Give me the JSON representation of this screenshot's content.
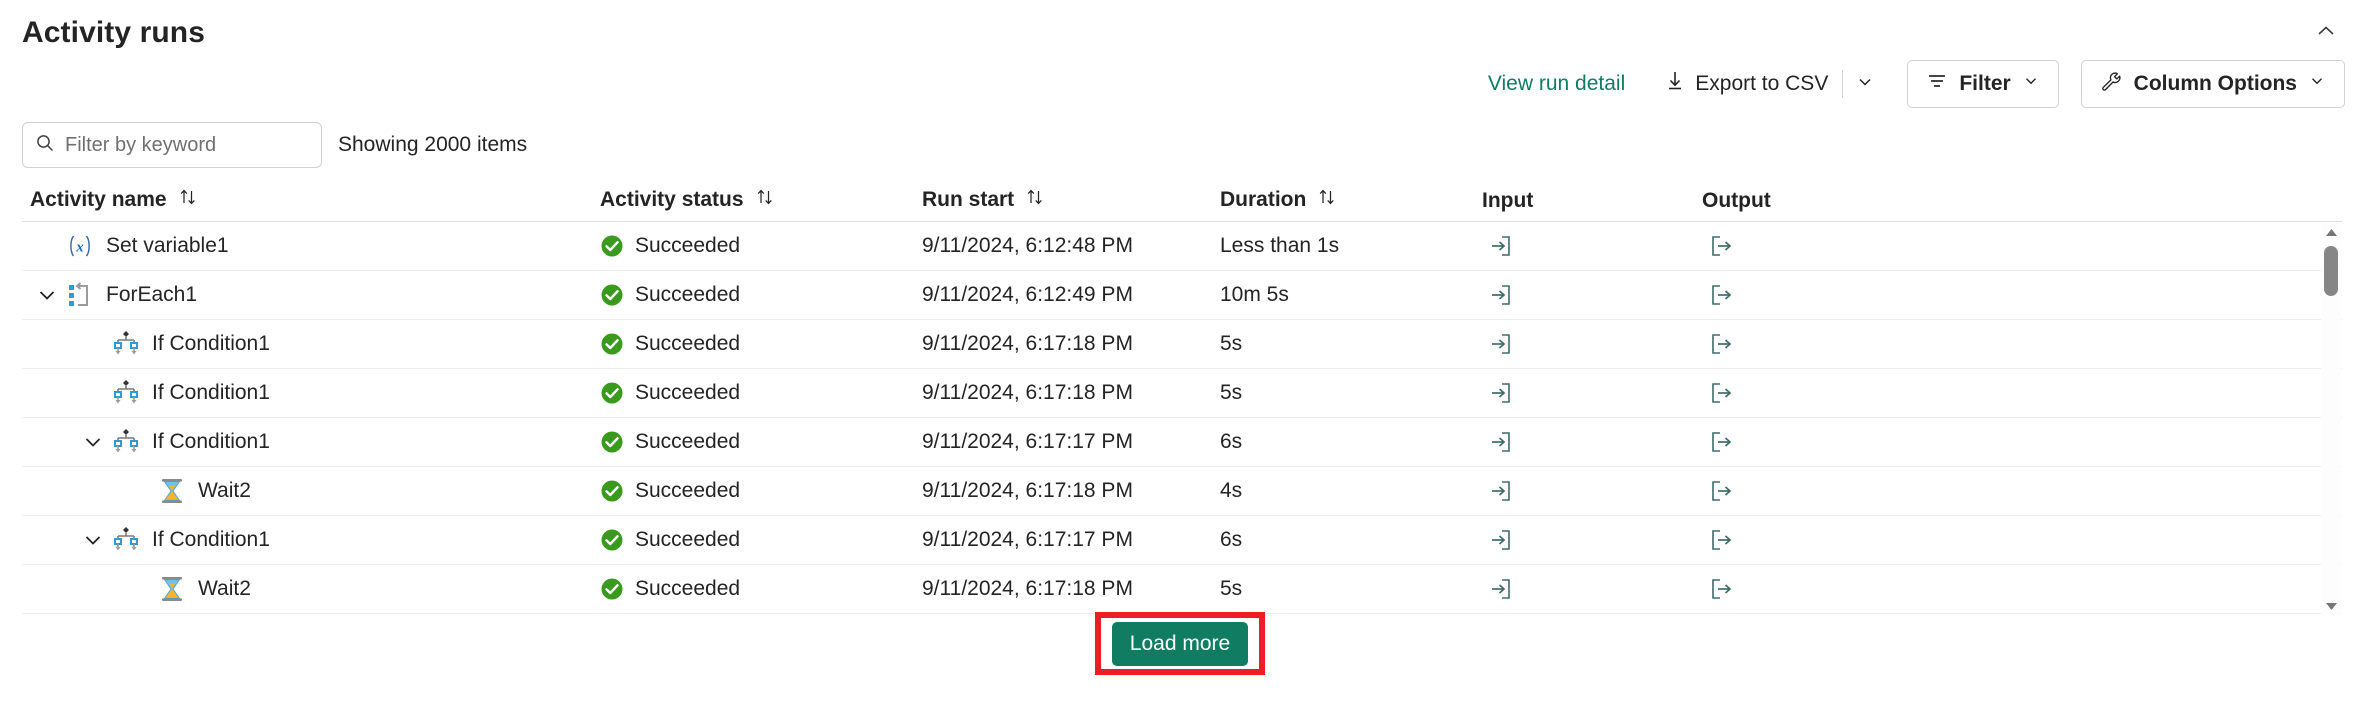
{
  "header": {
    "title": "Activity runs",
    "collapse_icon": "chevron-up-icon"
  },
  "toolbar": {
    "view_run_detail": "View run detail",
    "export_csv": "Export to CSV",
    "export_icon": "download-arrow-icon",
    "export_caret_icon": "chevron-down-icon",
    "filter": "Filter",
    "filter_icon": "filter-lines-icon",
    "filter_caret_icon": "chevron-down-icon",
    "column_options": "Column Options",
    "column_options_icon": "wrench-icon",
    "column_options_caret_icon": "chevron-down-icon"
  },
  "search": {
    "placeholder": "Filter by keyword",
    "value": "",
    "icon": "search-icon"
  },
  "status_line": "Showing 2000 items",
  "table": {
    "columns": [
      {
        "key": "name",
        "label": "Activity name",
        "sortable": true,
        "sort_icon": "sort-arrows-icon"
      },
      {
        "key": "status",
        "label": "Activity status",
        "sortable": true,
        "sort_icon": "sort-arrows-icon"
      },
      {
        "key": "start",
        "label": "Run start",
        "sortable": true,
        "sort_icon": "sort-arrows-icon"
      },
      {
        "key": "dur",
        "label": "Duration",
        "sortable": true,
        "sort_icon": "sort-arrows-icon"
      },
      {
        "key": "in",
        "label": "Input",
        "sortable": false,
        "sort_icon": ""
      },
      {
        "key": "out",
        "label": "Output",
        "sortable": false,
        "sort_icon": ""
      }
    ],
    "rows": [
      {
        "name": "Set variable1",
        "icon": "set-variable-icon",
        "indent": 0,
        "expandable": false,
        "expanded": false,
        "status": "Succeeded",
        "status_icon": "success-check-icon",
        "status_color": "#3a9a1e",
        "start": "9/11/2024, 6:12:48 PM",
        "duration": "Less than 1s",
        "input_icon": "input-arrow-icon",
        "output_icon": "output-arrow-icon"
      },
      {
        "name": "ForEach1",
        "icon": "foreach-loop-icon",
        "indent": 0,
        "expandable": true,
        "expanded": true,
        "status": "Succeeded",
        "status_icon": "success-check-icon",
        "status_color": "#3a9a1e",
        "start": "9/11/2024, 6:12:49 PM",
        "duration": "10m 5s",
        "input_icon": "input-arrow-icon",
        "output_icon": "output-arrow-icon"
      },
      {
        "name": "If Condition1",
        "icon": "if-condition-icon",
        "indent": 1,
        "expandable": false,
        "expanded": false,
        "status": "Succeeded",
        "status_icon": "success-check-icon",
        "status_color": "#3a9a1e",
        "start": "9/11/2024, 6:17:18 PM",
        "duration": "5s",
        "input_icon": "input-arrow-icon",
        "output_icon": "output-arrow-icon"
      },
      {
        "name": "If Condition1",
        "icon": "if-condition-icon",
        "indent": 1,
        "expandable": false,
        "expanded": false,
        "status": "Succeeded",
        "status_icon": "success-check-icon",
        "status_color": "#3a9a1e",
        "start": "9/11/2024, 6:17:18 PM",
        "duration": "5s",
        "input_icon": "input-arrow-icon",
        "output_icon": "output-arrow-icon"
      },
      {
        "name": "If Condition1",
        "icon": "if-condition-icon",
        "indent": 1,
        "expandable": true,
        "expanded": true,
        "status": "Succeeded",
        "status_icon": "success-check-icon",
        "status_color": "#3a9a1e",
        "start": "9/11/2024, 6:17:17 PM",
        "duration": "6s",
        "input_icon": "input-arrow-icon",
        "output_icon": "output-arrow-icon"
      },
      {
        "name": "Wait2",
        "icon": "hourglass-icon",
        "indent": 2,
        "expandable": false,
        "expanded": false,
        "status": "Succeeded",
        "status_icon": "success-check-icon",
        "status_color": "#3a9a1e",
        "start": "9/11/2024, 6:17:18 PM",
        "duration": "4s",
        "input_icon": "input-arrow-icon",
        "output_icon": "output-arrow-icon"
      },
      {
        "name": "If Condition1",
        "icon": "if-condition-icon",
        "indent": 1,
        "expandable": true,
        "expanded": true,
        "status": "Succeeded",
        "status_icon": "success-check-icon",
        "status_color": "#3a9a1e",
        "start": "9/11/2024, 6:17:17 PM",
        "duration": "6s",
        "input_icon": "input-arrow-icon",
        "output_icon": "output-arrow-icon"
      },
      {
        "name": "Wait2",
        "icon": "hourglass-icon",
        "indent": 2,
        "expandable": false,
        "expanded": false,
        "status": "Succeeded",
        "status_icon": "success-check-icon",
        "status_color": "#3a9a1e",
        "start": "9/11/2024, 6:17:18 PM",
        "duration": "5s",
        "input_icon": "input-arrow-icon",
        "output_icon": "output-arrow-icon"
      }
    ]
  },
  "load_more": {
    "label": "Load more",
    "button_color": "#107c62",
    "highlight_color": "#ee1c25"
  },
  "scrollbar": {
    "up_icon": "scroll-up-arrow-icon",
    "down_icon": "scroll-down-arrow-icon"
  },
  "colors": {
    "accent": "#107c62",
    "success": "#3a9a1e",
    "text": "#242424",
    "border": "#e0e0e0",
    "highlight": "#ee1c25"
  }
}
